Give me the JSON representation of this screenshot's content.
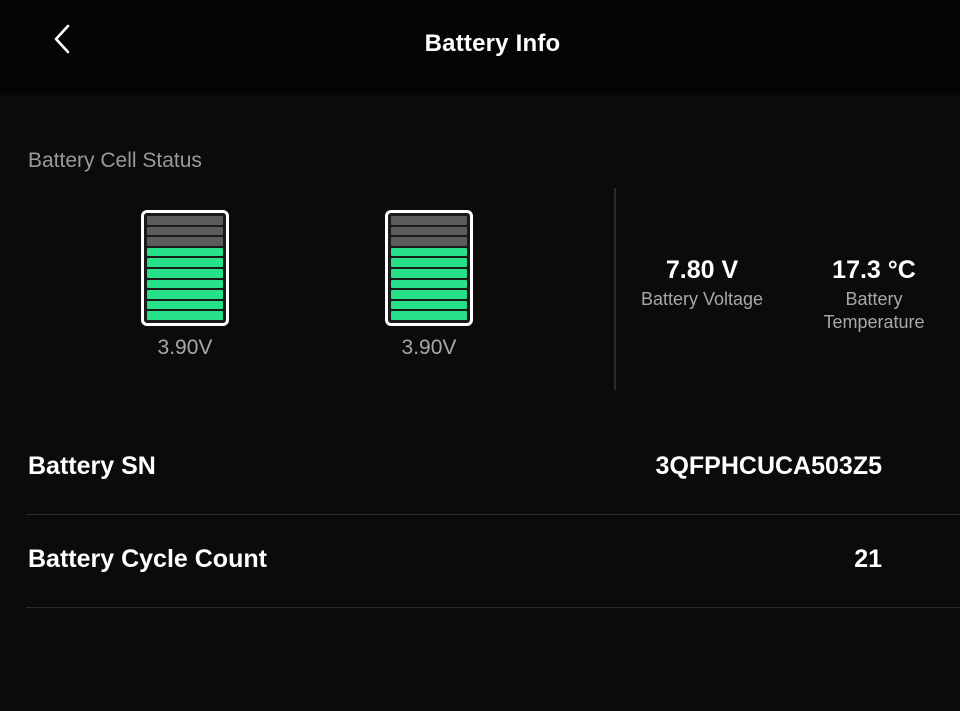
{
  "header": {
    "title": "Battery Info",
    "back_icon": "chevron-left-icon"
  },
  "cell_status": {
    "section_label": "Battery Cell Status",
    "cells": [
      {
        "voltage": "3.90V",
        "level_fraction": 0.7
      },
      {
        "voltage": "3.90V",
        "level_fraction": 0.7
      }
    ]
  },
  "stats": {
    "voltage": {
      "value": "7.80 V",
      "label": "Battery Voltage"
    },
    "temperature": {
      "value": "17.3 °C",
      "label_line1": "Battery",
      "label_line2": "Temperature"
    }
  },
  "info_rows": {
    "serial": {
      "label": "Battery SN",
      "value": "3QFPHCUCA503Z5"
    },
    "cycle_count": {
      "label": "Battery Cycle Count",
      "value": "21"
    }
  },
  "colors": {
    "background": "#0b0b0b",
    "cell_fill": "#26e08a",
    "cell_empty": "#5c5c5c",
    "muted_text": "#a8a8a8"
  }
}
